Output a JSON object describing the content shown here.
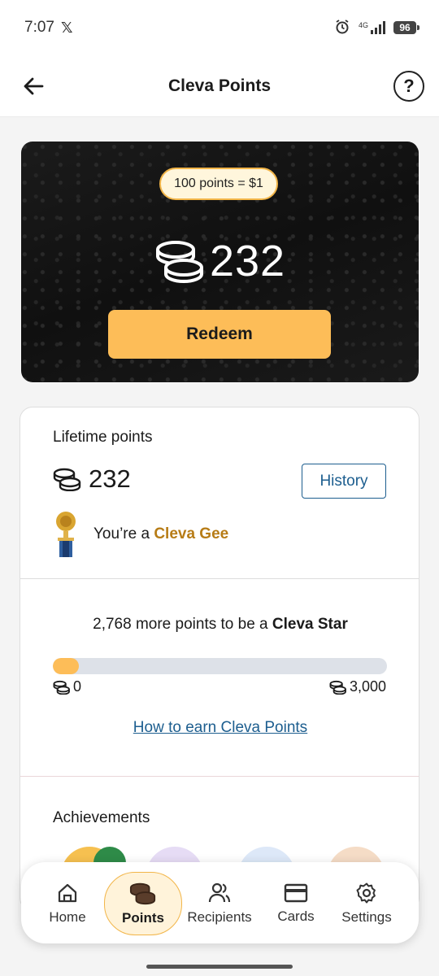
{
  "status_bar": {
    "time": "7:07",
    "social_glyph": "𝕏",
    "network": "4G",
    "battery": "96"
  },
  "header": {
    "title": "Cleva Points",
    "help_glyph": "?"
  },
  "points_card": {
    "rate": "100 points = $1",
    "balance": "232",
    "redeem_label": "Redeem"
  },
  "lifetime": {
    "label": "Lifetime points",
    "value": "232",
    "history_label": "History",
    "rank_prefix": "You’re a ",
    "rank_name": "Cleva Gee"
  },
  "progress": {
    "message_prefix": "2,768 more points to be a ",
    "next_rank": "Cleva Star",
    "fraction": 0.077,
    "min_label": "0",
    "max_label": "3,000",
    "earn_link": "How to earn Cleva Points"
  },
  "achievements": {
    "label": "Achievements"
  },
  "nav": {
    "items": [
      {
        "label": "Home",
        "icon": "home-icon"
      },
      {
        "label": "Points",
        "icon": "coins-icon",
        "active": true
      },
      {
        "label": "Recipients",
        "icon": "users-icon"
      },
      {
        "label": "Cards",
        "icon": "card-icon"
      },
      {
        "label": "Settings",
        "icon": "gear-icon"
      }
    ]
  },
  "colors": {
    "accent": "#fdbd58",
    "link": "#1d5e8f",
    "rank": "#b77c16",
    "card_dark": "#141414"
  }
}
